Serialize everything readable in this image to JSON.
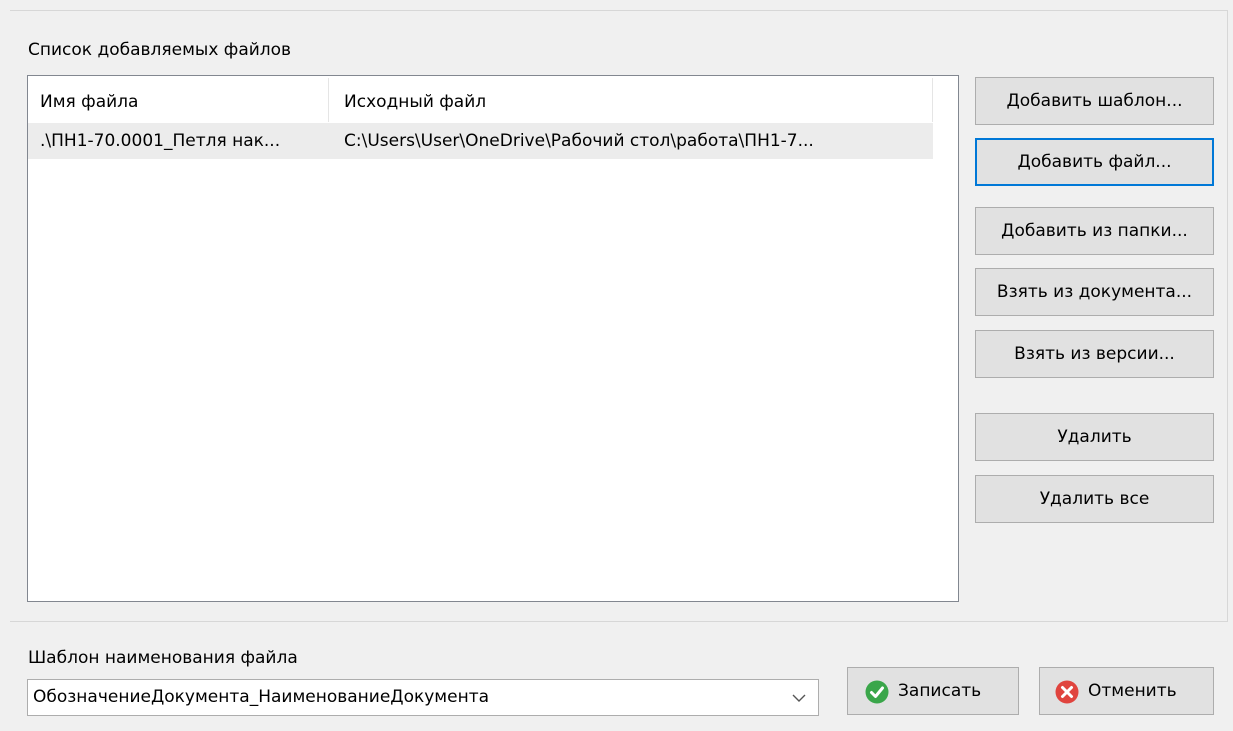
{
  "files_group": {
    "label": "Список добавляемых файлов",
    "columns": [
      "Имя файла",
      "Исходный файл"
    ],
    "rows": [
      {
        "name": ".\\ПН1-70.0001_Петля нак...",
        "source": "C:\\Users\\User\\OneDrive\\Рабочий стол\\работа\\ПН1-7..."
      }
    ]
  },
  "buttons": {
    "add_template": "Добавить шаблон...",
    "add_file": "Добавить файл...",
    "add_from_folder": "Добавить из папки...",
    "take_from_document": "Взять из документа...",
    "take_from_version": "Взять из версии...",
    "delete": "Удалить",
    "delete_all": "Удалить все"
  },
  "filename_template": {
    "label": "Шаблон наименования файла",
    "value": "ОбозначениеДокумента_НаименованиеДокумента"
  },
  "actions": {
    "save_label": "Записать",
    "save_icon": "green-check-icon",
    "cancel_label": "Отменить",
    "cancel_icon": "red-x-icon"
  },
  "colors": {
    "accent": "#0078d7",
    "ok": "#3aa64a",
    "cancel": "#e0443e"
  }
}
